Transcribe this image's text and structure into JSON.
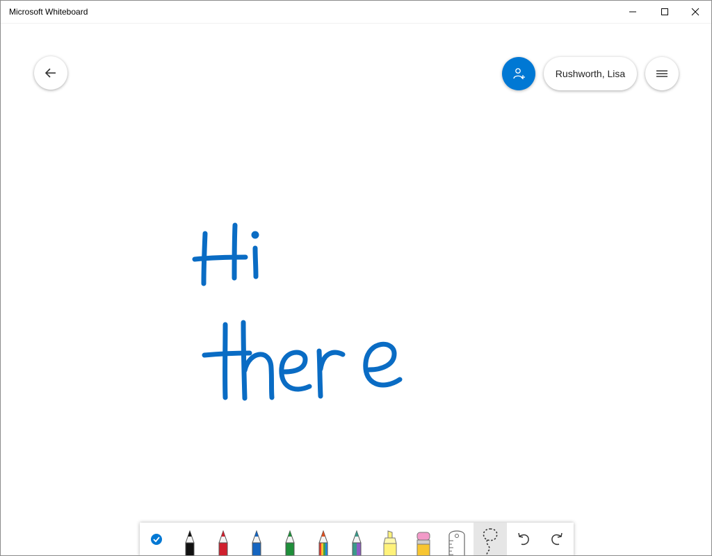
{
  "window": {
    "title": "Microsoft Whiteboard",
    "controls": [
      "minimize",
      "maximize",
      "close"
    ]
  },
  "header": {
    "back_icon": "arrow-left-icon",
    "share_icon": "add-person-icon",
    "user_name": "Rushworth, Lisa",
    "menu_icon": "hamburger-menu-icon"
  },
  "ink": {
    "color": "#0a6cc4",
    "lines": [
      "Hi",
      "there"
    ]
  },
  "toolbar": {
    "tools": [
      {
        "name": "select-ink-toggle",
        "icon": "check-circle-icon",
        "color": "#0078d4"
      },
      {
        "name": "pen-black",
        "icon": "pen-icon",
        "color": "#111111"
      },
      {
        "name": "pen-red",
        "icon": "pen-icon",
        "color": "#d0202e"
      },
      {
        "name": "pen-blue",
        "icon": "pen-icon",
        "color": "#1565c0"
      },
      {
        "name": "pen-green",
        "icon": "pen-icon",
        "color": "#1f8f3a"
      },
      {
        "name": "pen-rainbow",
        "icon": "pen-icon",
        "color": "#e05020"
      },
      {
        "name": "pen-galaxy",
        "icon": "pen-icon",
        "color": "#3a9a8a"
      },
      {
        "name": "highlighter-yellow",
        "icon": "highlighter-icon",
        "color": "#fff27a"
      },
      {
        "name": "eraser",
        "icon": "eraser-icon",
        "color": "#f29ac8"
      },
      {
        "name": "ruler",
        "icon": "ruler-icon",
        "color": "#ffffff"
      },
      {
        "name": "lasso-select",
        "icon": "lasso-icon",
        "color": "#333333",
        "selected": true
      },
      {
        "name": "undo",
        "icon": "undo-icon",
        "color": "#333333"
      },
      {
        "name": "redo",
        "icon": "redo-icon",
        "color": "#333333"
      }
    ]
  }
}
